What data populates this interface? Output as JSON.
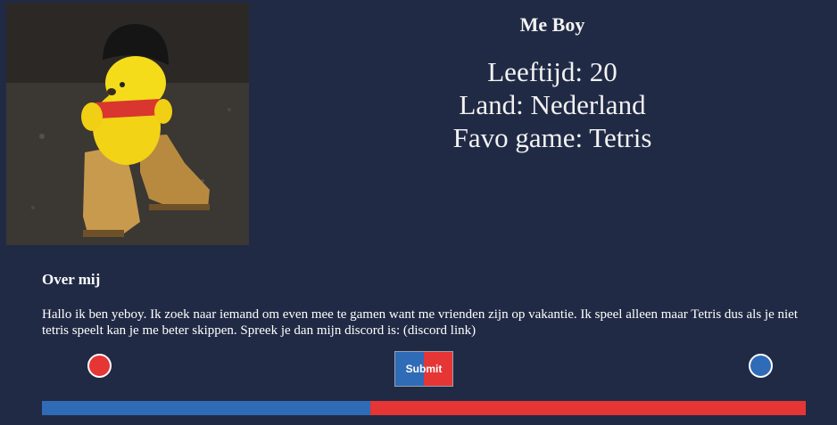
{
  "profile": {
    "name": "Me Boy",
    "facts": [
      "Leeftijd: 20",
      "Land: Nederland",
      "Favo game: Tetris"
    ]
  },
  "about": {
    "title": "Over mij",
    "text": "Hallo ik ben yeboy. Ik zoek naar iemand om even mee te gamen want me vrienden zijn op vakantie. Ik speel alleen maar Tetris dus als je niet tetris speelt kan je me beter skippen. Spreek je dan mijn discord is: (discord link)"
  },
  "actions": {
    "submit_label": "Submit",
    "left_color": "#e53535",
    "right_color": "#2f6bb6"
  },
  "progress": {
    "fraction": 0.43,
    "fill_color": "#2f6bb6",
    "track_color": "#e53535"
  },
  "colors": {
    "background": "#212a45"
  }
}
